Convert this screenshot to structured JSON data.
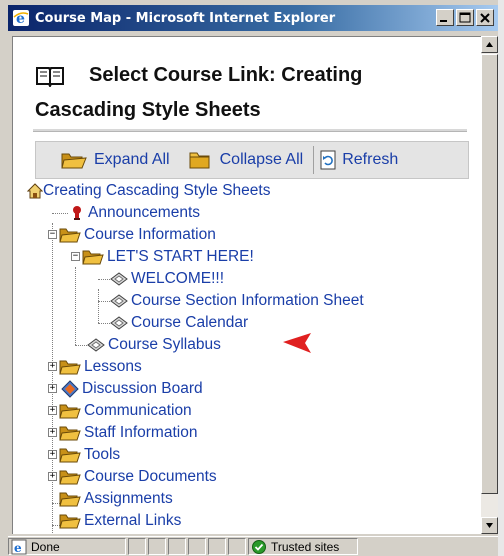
{
  "window": {
    "title": "Course Map - Microsoft Internet Explorer"
  },
  "heading": {
    "line1": "Select Course Link: Creating",
    "line2": "Cascading Style Sheets"
  },
  "toolbar": {
    "expand_all": "Expand All",
    "collapse_all": "Collapse All",
    "refresh": "Refresh"
  },
  "tree": {
    "root": "Creating Cascading Style Sheets",
    "items": [
      {
        "label": "Announcements",
        "icon": "announcement-icon"
      },
      {
        "label": "Course Information",
        "icon": "folder-icon"
      },
      {
        "label": "LET'S START HERE!",
        "icon": "folder-icon"
      },
      {
        "label": "WELCOME!!!",
        "icon": "document-icon"
      },
      {
        "label": "Course Section Information Sheet",
        "icon": "document-icon"
      },
      {
        "label": "Course Calendar",
        "icon": "document-icon"
      },
      {
        "label": "Course Syllabus",
        "icon": "document-icon"
      },
      {
        "label": "Lessons",
        "icon": "folder-icon"
      },
      {
        "label": "Discussion Board",
        "icon": "discussion-icon"
      },
      {
        "label": "Communication",
        "icon": "folder-icon"
      },
      {
        "label": "Staff Information",
        "icon": "folder-icon"
      },
      {
        "label": "Tools",
        "icon": "folder-icon"
      },
      {
        "label": "Course Documents",
        "icon": "folder-icon"
      },
      {
        "label": "Assignments",
        "icon": "folder-icon"
      },
      {
        "label": "External Links",
        "icon": "folder-icon"
      }
    ]
  },
  "statusbar": {
    "status": "Done",
    "zone": "Trusted sites"
  },
  "colors": {
    "link": "#1a3ea8",
    "titlebar_start": "#0a246a",
    "arrow": "#e02020"
  }
}
